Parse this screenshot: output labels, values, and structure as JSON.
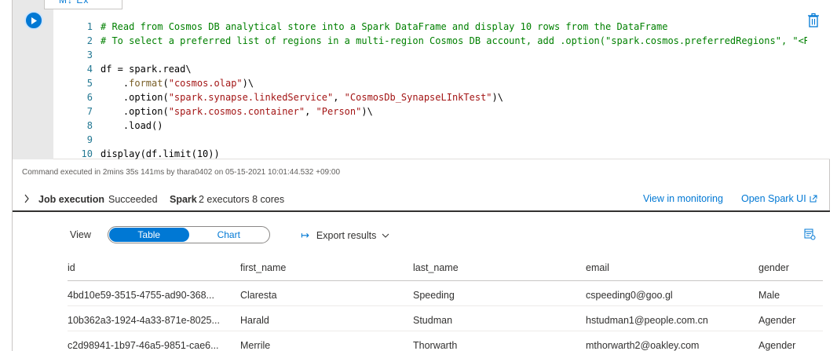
{
  "cell": {
    "tooltip": "M↓ Ex",
    "code_lines": [
      [
        {
          "t": "# Read from Cosmos DB analytical store into a Spark DataFrame and display 10 rows from the DataFrame",
          "c": "comment"
        }
      ],
      [
        {
          "t": "# To select a preferred list of regions in a multi-region Cosmos DB account, add .option(\"spark.cosmos.preferredRegions\", \"<Re",
          "c": "comment"
        }
      ],
      [
        {
          "t": "",
          "c": ""
        }
      ],
      [
        {
          "t": "df = spark.read\\",
          "c": ""
        }
      ],
      [
        {
          "t": "    .",
          "c": ""
        },
        {
          "t": "format",
          "c": "func"
        },
        {
          "t": "(",
          "c": ""
        },
        {
          "t": "\"cosmos.olap\"",
          "c": "str"
        },
        {
          "t": ")\\",
          "c": ""
        }
      ],
      [
        {
          "t": "    .option(",
          "c": ""
        },
        {
          "t": "\"spark.synapse.linkedService\"",
          "c": "str"
        },
        {
          "t": ", ",
          "c": ""
        },
        {
          "t": "\"CosmosDb_SynapseLInkTest\"",
          "c": "str"
        },
        {
          "t": ")\\",
          "c": ""
        }
      ],
      [
        {
          "t": "    .option(",
          "c": ""
        },
        {
          "t": "\"spark.cosmos.container\"",
          "c": "str"
        },
        {
          "t": ", ",
          "c": ""
        },
        {
          "t": "\"Person\"",
          "c": "str"
        },
        {
          "t": ")\\",
          "c": ""
        }
      ],
      [
        {
          "t": "    .load()",
          "c": ""
        }
      ],
      [
        {
          "t": "",
          "c": ""
        }
      ],
      [
        {
          "t": "display(df.limit(10))",
          "c": ""
        }
      ]
    ],
    "line_numbers": [
      "1",
      "2",
      "3",
      "4",
      "5",
      "6",
      "7",
      "8",
      "9",
      "10"
    ]
  },
  "status": {
    "executed_text": "Command executed in 2mins 35s 141ms by thara0402 on 05-15-2021 10:01:44.532 +09:00"
  },
  "job": {
    "label": "Job execution",
    "status": "Succeeded",
    "spark_label": "Spark",
    "spark_info": "2 executors 8 cores",
    "view_monitoring": "View in monitoring",
    "open_spark_ui": "Open Spark UI"
  },
  "results": {
    "view_label": "View",
    "tab_table": "Table",
    "tab_chart": "Chart",
    "export_label": "Export results",
    "columns": [
      "id",
      "first_name",
      "last_name",
      "email",
      "gender"
    ],
    "rows": [
      [
        "4bd10e59-3515-4755-ad90-368...",
        "Claresta",
        "Speeding",
        "cspeeding0@goo.gl",
        "Male"
      ],
      [
        "10b362a3-1924-4a33-871e-8025...",
        "Harald",
        "Studman",
        "hstudman1@people.com.cn",
        "Agender"
      ],
      [
        "c2d98941-1b97-46a5-9851-cae6...",
        "Merrile",
        "Thorwarth",
        "mthorwarth2@oakley.com",
        "Agender"
      ]
    ]
  },
  "colors": {
    "accent": "#0078d4",
    "comment": "#008000",
    "string": "#a31515",
    "function": "#795e26"
  }
}
